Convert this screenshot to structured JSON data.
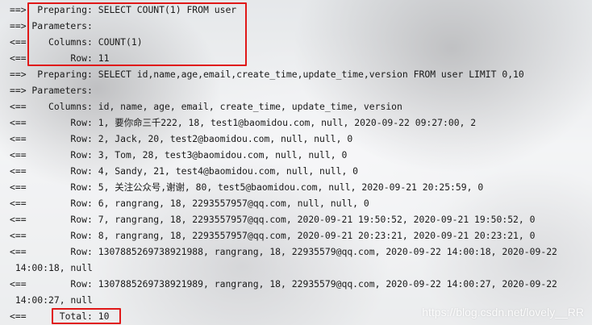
{
  "log_lines": [
    "==>  Preparing: SELECT COUNT(1) FROM user",
    "==> Parameters: ",
    "<==    Columns: COUNT(1)",
    "<==        Row: 11",
    "==>  Preparing: SELECT id,name,age,email,create_time,update_time,version FROM user LIMIT 0,10",
    "==> Parameters: ",
    "<==    Columns: id, name, age, email, create_time, update_time, version",
    "<==        Row: 1, 要你命三千222, 18, test1@baomidou.com, null, 2020-09-22 09:27:00, 2",
    "<==        Row: 2, Jack, 20, test2@baomidou.com, null, null, 0",
    "<==        Row: 3, Tom, 28, test3@baomidou.com, null, null, 0",
    "<==        Row: 4, Sandy, 21, test4@baomidou.com, null, null, 0",
    "<==        Row: 5, 关注公众号,谢谢, 80, test5@baomidou.com, null, 2020-09-21 20:25:59, 0",
    "<==        Row: 6, rangrang, 18, 2293557957@qq.com, null, null, 0",
    "<==        Row: 7, rangrang, 18, 2293557957@qq.com, 2020-09-21 19:50:52, 2020-09-21 19:50:52, 0",
    "<==        Row: 8, rangrang, 18, 2293557957@qq.com, 2020-09-21 20:23:21, 2020-09-21 20:23:21, 0",
    "<==        Row: 1307885269738921988, rangrang, 18, 22935579@qq.com, 2020-09-22 14:00:18, 2020-09-22",
    " 14:00:18, null",
    "<==        Row: 1307885269738921989, rangrang, 18, 22935579@qq.com, 2020-09-22 14:00:27, 2020-09-22",
    " 14:00:27, null",
    "<==      Total: 10"
  ],
  "watermark": "https://blog.csdn.net/lovely__RR",
  "highlight_color": "#e01818"
}
